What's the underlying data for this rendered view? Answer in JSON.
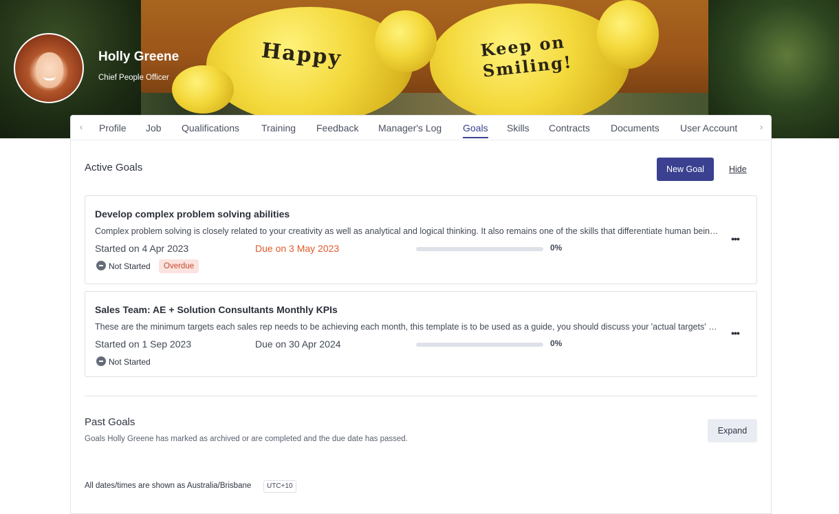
{
  "profile": {
    "name": "Holly Greene",
    "title": "Chief People Officer",
    "banner_text_left": "Happy",
    "banner_text_right": "Keep on Smiling!"
  },
  "tabs": [
    {
      "label": "Profile",
      "active": false
    },
    {
      "label": "Job",
      "active": false
    },
    {
      "label": "Qualifications",
      "active": false
    },
    {
      "label": "Training",
      "active": false
    },
    {
      "label": "Feedback",
      "active": false
    },
    {
      "label": "Manager's Log",
      "active": false
    },
    {
      "label": "Goals",
      "active": true
    },
    {
      "label": "Skills",
      "active": false
    },
    {
      "label": "Contracts",
      "active": false
    },
    {
      "label": "Documents",
      "active": false
    },
    {
      "label": "User Account",
      "active": false
    }
  ],
  "tab_nav": {
    "prev_icon": "chevron-left-icon",
    "next_icon": "chevron-right-icon"
  },
  "active_goals": {
    "title": "Active Goals",
    "new_goal_label": "New Goal",
    "hide_label": "Hide",
    "goals": [
      {
        "title": "Develop complex problem solving abilities",
        "description": "Complex problem solving is closely related to your creativity as well as analytical and logical thinking. It also remains one of the skills that differentiate human beings from machines.",
        "started": "Started on 4 Apr 2023",
        "due": "Due on 3 May 2023",
        "overdue": true,
        "progress": "0%",
        "progress_value": 0,
        "status": "Not Started",
        "badge": "Overdue"
      },
      {
        "title": "Sales Team: AE + Solution Consultants Monthly KPIs",
        "description": "These are the minimum targets each sales rep needs to be achieving each month, this template is to be used as a guide, you should discuss your 'actual targets' with your manager.",
        "started": "Started on 1 Sep 2023",
        "due": "Due on 30 Apr 2024",
        "overdue": false,
        "progress": "0%",
        "progress_value": 0,
        "status": "Not Started",
        "badge": ""
      }
    ]
  },
  "past_goals": {
    "title": "Past Goals",
    "description": "Goals Holly Greene has marked as archived or are completed and the due date has passed.",
    "expand_label": "Expand"
  },
  "timezone": {
    "note": "All dates/times are shown as Australia/Brisbane",
    "offset": "UTC+10"
  },
  "colors": {
    "accent": "#3b4190",
    "overdue": "#e05a2b",
    "badge_bg": "#fbe3df"
  }
}
